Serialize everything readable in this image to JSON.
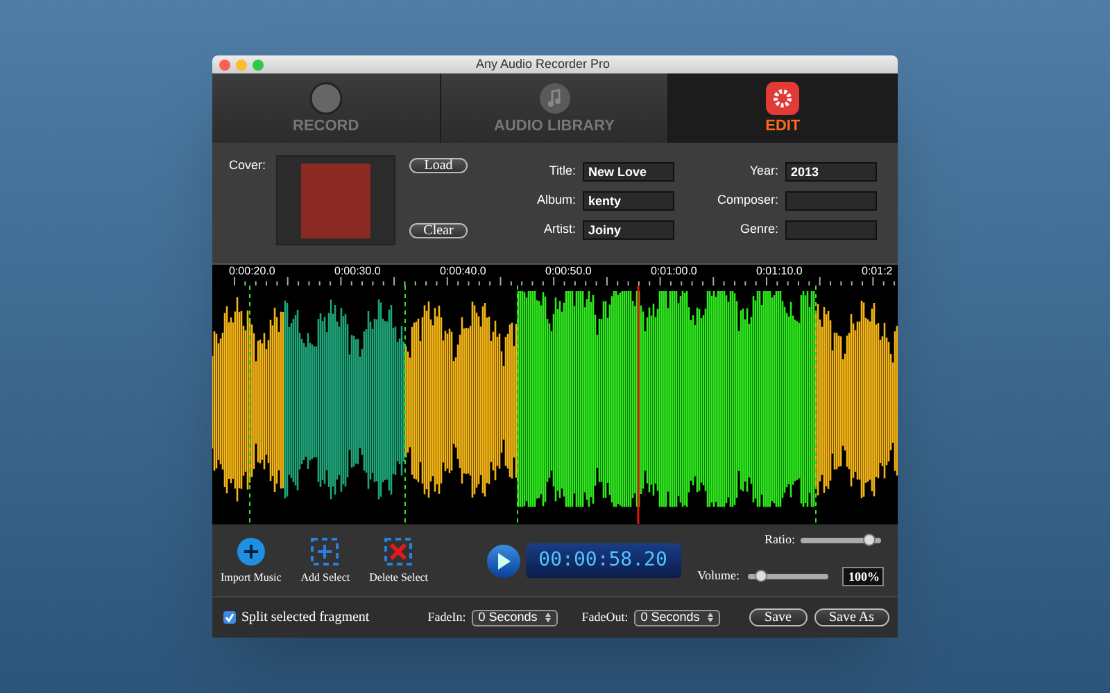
{
  "window": {
    "title": "Any Audio Recorder Pro"
  },
  "tabs": [
    {
      "label": "RECORD",
      "kind": "record",
      "selected": false
    },
    {
      "label": "AUDIO LIBRARY",
      "kind": "library",
      "selected": false
    },
    {
      "label": "EDIT",
      "kind": "edit",
      "selected": true
    }
  ],
  "cover": {
    "label": "Cover:",
    "buttons": [
      "Load",
      "Clear"
    ]
  },
  "fields": [
    {
      "label": "Title:",
      "value": "New Love"
    },
    {
      "label": "Year:",
      "value": "2013"
    },
    {
      "label": "Album:",
      "value": "kenty"
    },
    {
      "label": "Composer:"
    },
    {
      "label": "Artist:",
      "value": "Joiny"
    },
    {
      "label": "Genre:"
    }
  ],
  "ruler": [
    "0:00:20.0",
    "0:00:30.0",
    "0:00:40.0",
    "0:00:50.0",
    "0:01:00.0",
    "0:01:10.0",
    "0:01:2"
  ],
  "tools": [
    {
      "label": "Import Music",
      "kind": "import"
    },
    {
      "label": "Add Select",
      "kind": "add"
    },
    {
      "label": "Delete Select",
      "kind": "delete"
    }
  ],
  "time": "00:00:58.20",
  "ratio": {
    "label": "Ratio:",
    "level": 0.85
  },
  "volume": {
    "label": "Volume:",
    "level": 0.15,
    "value": "100%"
  },
  "split": {
    "label": "Split selected fragment",
    "checked": true
  },
  "fade_in": {
    "label": "FadeIn:",
    "value": "0 Seconds"
  },
  "fade_out": {
    "label": "FadeOut:",
    "value": "0 Seconds"
  },
  "actions": [
    "Save",
    "Save As"
  ]
}
